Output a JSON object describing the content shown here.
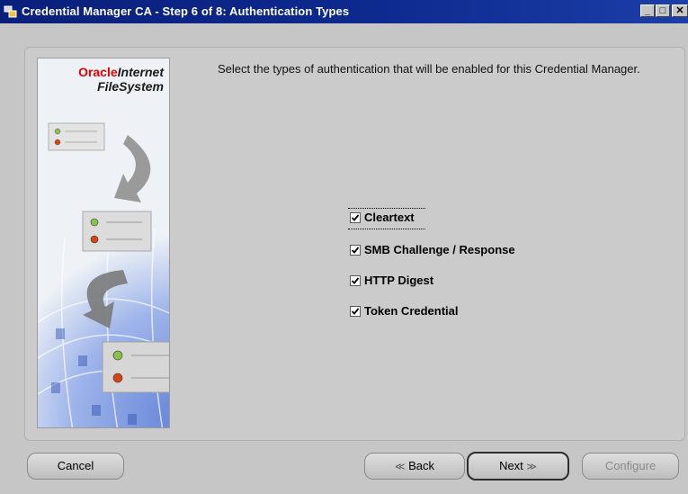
{
  "window": {
    "title": "Credential Manager CA - Step 6 of 8: Authentication Types",
    "minimize_glyph": "_",
    "maximize_glyph": "□",
    "close_glyph": "✕"
  },
  "branding": {
    "oracle": "Oracle",
    "internet": "Internet",
    "filesystem": "FileSystem"
  },
  "instructions": "Select the types of authentication that will be enabled for this Credential Manager.",
  "auth_types": [
    {
      "label": "Cleartext",
      "checked": true
    },
    {
      "label": "SMB Challenge / Response",
      "checked": true
    },
    {
      "label": "HTTP Digest",
      "checked": true
    },
    {
      "label": "Token Credential",
      "checked": true
    }
  ],
  "buttons": {
    "cancel": "Cancel",
    "back": "Back",
    "back_arrow": "≪",
    "next": "Next",
    "next_arrow": "≫",
    "configure": "Configure"
  },
  "colors": {
    "titlebar": "#0a1f7a",
    "oracle_red": "#e30000",
    "window_bg": "#c6c6c6"
  }
}
